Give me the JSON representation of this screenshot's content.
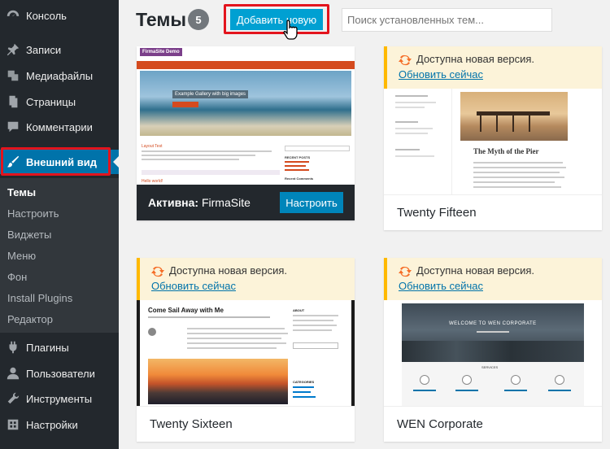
{
  "sidebar": {
    "items": [
      {
        "label": "Консоль",
        "icon": "dashboard-icon"
      },
      {
        "label": "Записи",
        "icon": "pin-icon"
      },
      {
        "label": "Медиафайлы",
        "icon": "media-icon"
      },
      {
        "label": "Страницы",
        "icon": "pages-icon"
      },
      {
        "label": "Комментарии",
        "icon": "comment-icon"
      },
      {
        "label": "Внешний вид",
        "icon": "brush-icon"
      },
      {
        "label": "Плагины",
        "icon": "plug-icon"
      },
      {
        "label": "Пользователи",
        "icon": "user-icon"
      },
      {
        "label": "Инструменты",
        "icon": "wrench-icon"
      },
      {
        "label": "Настройки",
        "icon": "settings-icon"
      }
    ],
    "submenu": [
      "Темы",
      "Настроить",
      "Виджеты",
      "Меню",
      "Фон",
      "Install Plugins",
      "Редактор"
    ]
  },
  "header": {
    "title": "Темы",
    "count": "5",
    "add_new": "Добавить новую",
    "search_placeholder": "Поиск установленных тем..."
  },
  "themes": {
    "firmasite": {
      "active_prefix": "Активна:",
      "name": "FirmaSite",
      "customize": "Настроить",
      "shot": {
        "site_title": "FirmaSite Demo",
        "hero_caption": "Example Gallery with big images",
        "post_title": "Layout Test",
        "widget_title": "RECENT POSTS",
        "widget_title2": "Recent Comments",
        "post2": "Hello world!"
      }
    },
    "twentyfifteen": {
      "name": "Twenty Fifteen",
      "notice": "Доступна новая версия.",
      "update": "Обновить сейчас",
      "shot": {
        "post_title": "The Myth of the Pier"
      }
    },
    "twentysixteen": {
      "name": "Twenty Sixteen",
      "notice": "Доступна новая версия.",
      "update": "Обновить сейчас",
      "shot": {
        "post_title": "Come Sail Away with Me",
        "about": "ABOUT",
        "categories": "CATEGORIES"
      }
    },
    "wencorporate": {
      "name": "WEN Corporate",
      "notice": "Доступна новая версия.",
      "update": "Обновить сейчас",
      "shot": {
        "hero_title": "WELCOME TO WEN CORPORATE",
        "services": "SERVICES"
      }
    }
  },
  "colors": {
    "accent": "#0073aa",
    "sidebar": "#23282d",
    "highlight": "#e3141d",
    "notice": "#ffb900"
  }
}
